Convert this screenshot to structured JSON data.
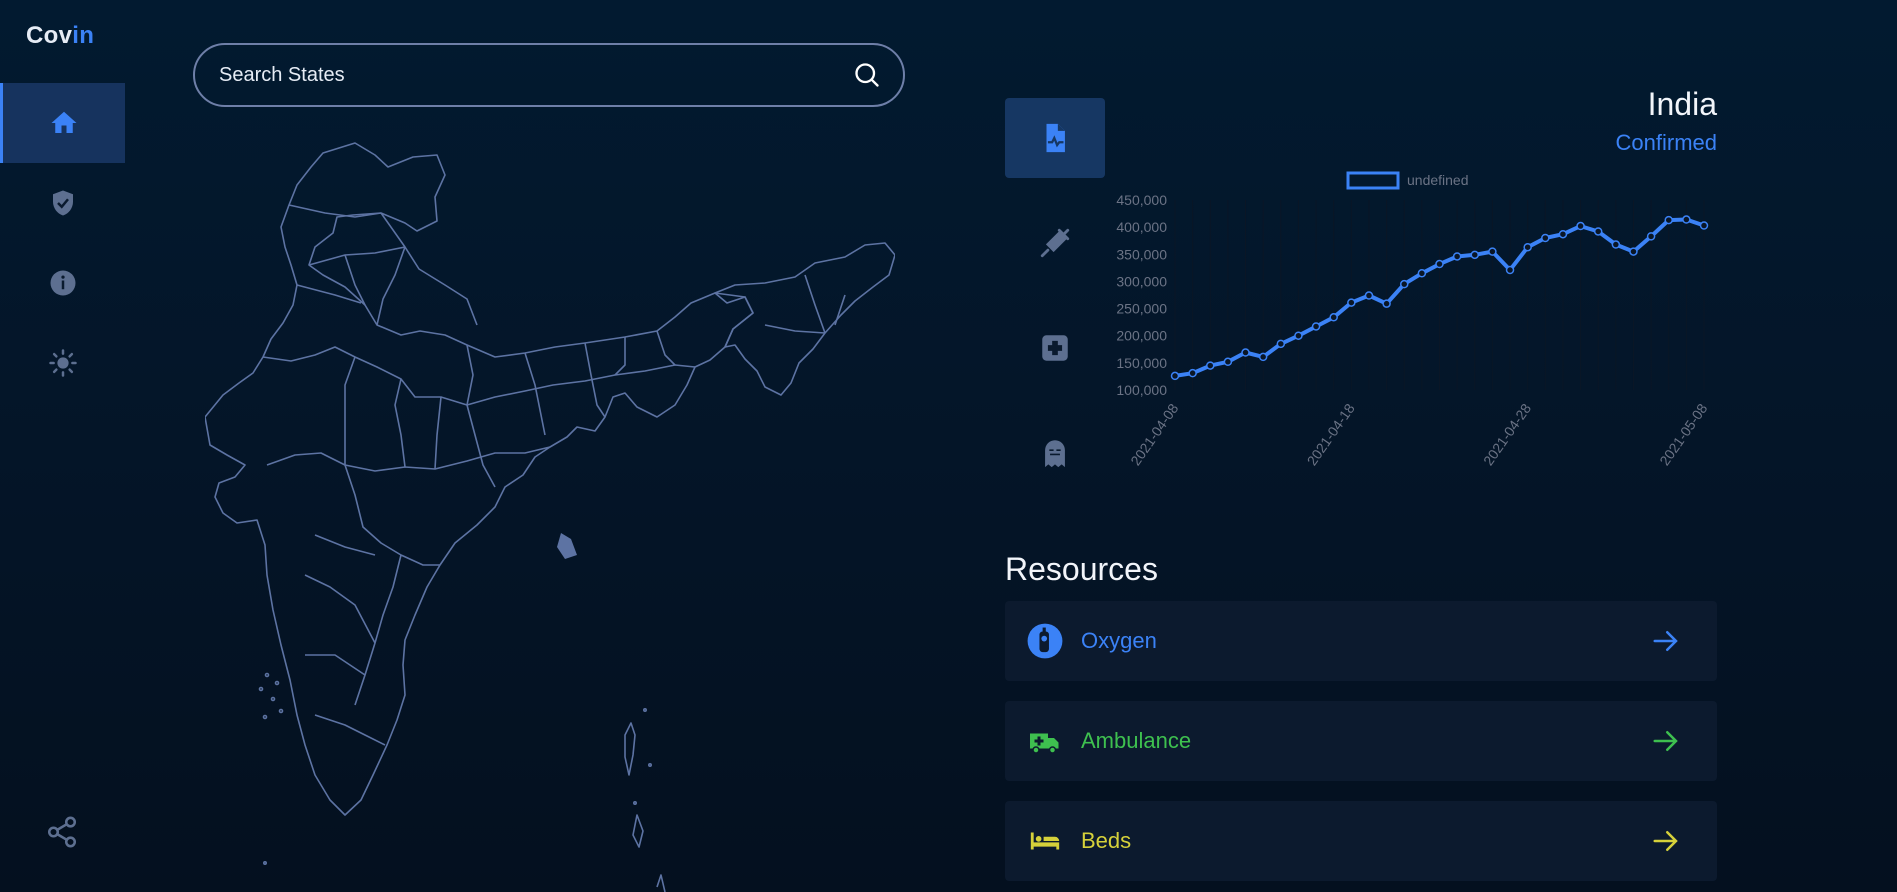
{
  "sidebar": {
    "logo_a": "Cov",
    "logo_b": "in",
    "items": [
      {
        "icon": "home-icon"
      },
      {
        "icon": "shield-check-icon"
      },
      {
        "icon": "info-icon"
      },
      {
        "icon": "sun-icon"
      }
    ],
    "share_icon": "share-icon"
  },
  "search": {
    "placeholder": "Search States"
  },
  "stat_tabs": [
    {
      "icon": "medical-file-icon"
    },
    {
      "icon": "syringe-icon"
    },
    {
      "icon": "medical-cross-icon"
    },
    {
      "icon": "ghost-icon"
    }
  ],
  "header": {
    "country": "India",
    "metric": "Confirmed"
  },
  "chart_data": {
    "type": "line",
    "legend": "undefined",
    "color": "#3b82f6",
    "y_ticks": [
      "450,000",
      "400,000",
      "350,000",
      "300,000",
      "250,000",
      "200,000",
      "150,000",
      "100,000"
    ],
    "x_ticks": [
      "2021-04-08",
      "2021-04-18",
      "2021-04-28",
      "2021-05-08"
    ],
    "ylim": [
      100000,
      450000
    ],
    "x": [
      "2021-04-08",
      "2021-04-09",
      "2021-04-10",
      "2021-04-11",
      "2021-04-12",
      "2021-04-13",
      "2021-04-14",
      "2021-04-15",
      "2021-04-16",
      "2021-04-17",
      "2021-04-18",
      "2021-04-19",
      "2021-04-20",
      "2021-04-21",
      "2021-04-22",
      "2021-04-23",
      "2021-04-24",
      "2021-04-25",
      "2021-04-26",
      "2021-04-27",
      "2021-04-28",
      "2021-04-29",
      "2021-04-30",
      "2021-05-01",
      "2021-05-02",
      "2021-05-03",
      "2021-05-04",
      "2021-05-05",
      "2021-05-06",
      "2021-05-07",
      "2021-05-08"
    ],
    "values": [
      126000,
      131000,
      145000,
      152000,
      169000,
      161000,
      185000,
      200000,
      217000,
      234000,
      261000,
      274000,
      259000,
      295000,
      315000,
      332000,
      346000,
      349000,
      355000,
      321000,
      363000,
      380000,
      387000,
      402000,
      392000,
      368000,
      355000,
      383000,
      413000,
      414000,
      403000
    ]
  },
  "resources": {
    "title": "Resources",
    "items": [
      {
        "label": "Oxygen",
        "color": "#3b82f6",
        "icon": "oxygen-tank-icon"
      },
      {
        "label": "Ambulance",
        "color": "#3ec04f",
        "icon": "ambulance-icon"
      },
      {
        "label": "Beds",
        "color": "#d6d13a",
        "icon": "bed-icon"
      }
    ]
  }
}
